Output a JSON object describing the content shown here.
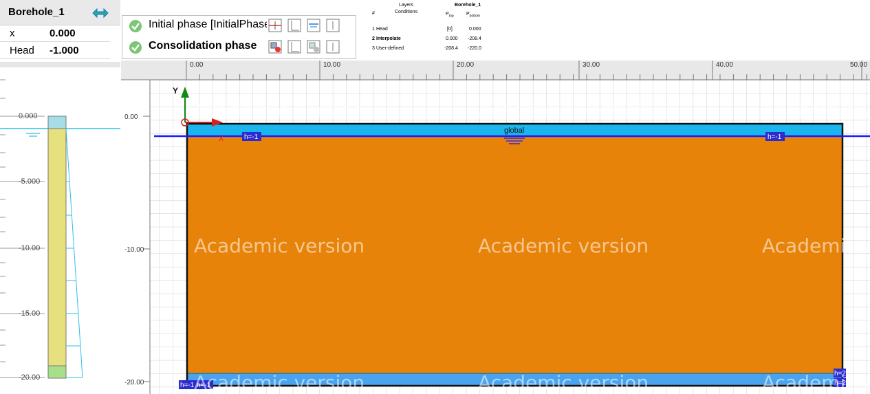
{
  "borehole_panel": {
    "title": "Borehole_1",
    "fields": [
      {
        "label": "x",
        "value": "0.000"
      },
      {
        "label": "Head",
        "value": "-1.000"
      }
    ],
    "depth_labels": [
      "0.000",
      "-5.000",
      "-10.00",
      "-15.00",
      "-20.00"
    ]
  },
  "phases": [
    {
      "name": "Initial phase [InitialPhase",
      "bold": false
    },
    {
      "name": "Consolidation phase",
      "bold": true
    }
  ],
  "conditions_table": {
    "headers": {
      "num": "#",
      "layers": "Layers",
      "conditions": "Conditions",
      "borehole": "Borehole_1",
      "p_top": "P",
      "p_top_sub": "top",
      "p_bottom": "P",
      "p_bottom_sub": "bottom"
    },
    "rows": [
      {
        "num": "1",
        "name": "Head",
        "top": "[0]",
        "bottom": "0.000",
        "bold": false
      },
      {
        "num": "2",
        "name": "Interpolate",
        "top": "0.000",
        "bottom": "-208.4",
        "bold": true
      },
      {
        "num": "3",
        "name": "User-defined",
        "top": "-208.4",
        "bottom": "-220.0",
        "bold": false
      }
    ]
  },
  "model_view": {
    "x_ticks": [
      "0.00",
      "10.00",
      "20.00",
      "30.00",
      "40.00",
      "50.00"
    ],
    "y_ticks": [
      "0.00",
      "-10.00",
      "-20.00"
    ],
    "axis_y": "Y",
    "axis_x": "X",
    "water_level_label": "global",
    "head_labels": [
      "h=-1",
      "h=-1",
      "h=-1",
      "h=-1",
      "h=2",
      "h=2"
    ],
    "watermark": "Academic version",
    "colors": {
      "soil": "#e8830a",
      "water_top": "#1bb6ee",
      "water_bottom": "#4aa3ee",
      "phreatic": "#1a1aff",
      "grid": "#c8c8c8"
    }
  }
}
